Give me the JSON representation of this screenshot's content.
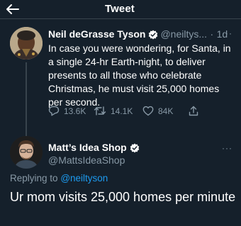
{
  "header": {
    "title": "Tweet"
  },
  "tweet": {
    "author_name": "Neil deGrasse Tyson",
    "author_handle": "@neiltys...",
    "separator": "·",
    "time": "1d",
    "more": "···",
    "text": "In case you were wondering, for Santa, in a single 24-hr Earth-night, to deliver presents to all those who celebrate Christmas, he must visit 25,000 homes per second.",
    "replies": "13.6K",
    "retweets": "14.1K",
    "likes": "84K"
  },
  "reply": {
    "author_name": "Matt’s Idea Shop",
    "author_handle": "@MattsIdeaShop",
    "more": "···",
    "replying_to_label": "Replying to",
    "replying_to_handle": "@neiltyson",
    "text": "Ur mom visits 25,000 homes per minute"
  },
  "colors": {
    "background": "#15202b",
    "text_primary": "#ffffff",
    "text_secondary": "#8899a6",
    "accent": "#1d9bf0",
    "divider": "#38444d"
  },
  "icons": [
    "back-arrow-icon",
    "verified-badge-icon",
    "more-dots-icon",
    "reply-icon",
    "retweet-icon",
    "like-icon",
    "share-icon"
  ]
}
